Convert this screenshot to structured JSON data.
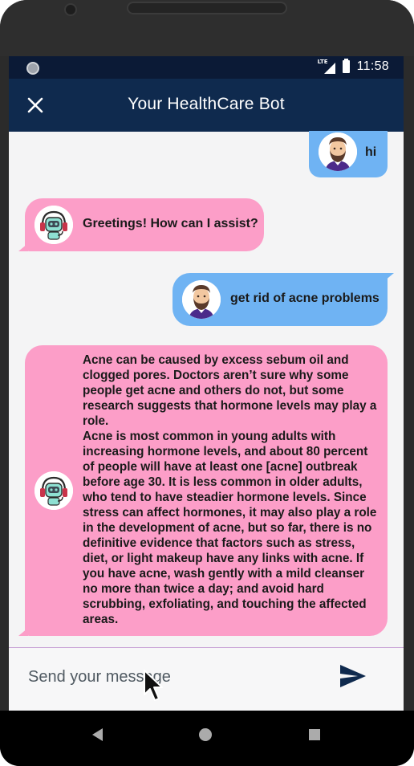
{
  "status_bar": {
    "network_label": "LTE",
    "time": "11:58",
    "icons": [
      "notification-dot-icon",
      "lte-signal-icon",
      "battery-icon"
    ]
  },
  "app_bar": {
    "title": "Your HealthCare Bot",
    "close_icon": "close-icon"
  },
  "colors": {
    "status_bar": "#0b1a36",
    "app_bar": "#0f2a4e",
    "user_bubble": "#6fb3f3",
    "bot_bubble": "#fc9ec8",
    "chat_background": "#f4f4f5",
    "send_icon": "#0f2a4e"
  },
  "messages": [
    {
      "sender": "user",
      "avatar": "bearded-man-avatar-icon",
      "text": "hi"
    },
    {
      "sender": "bot",
      "avatar": "robot-headset-avatar-icon",
      "text": "Greetings! How can I assist?"
    },
    {
      "sender": "user",
      "avatar": "bearded-man-avatar-icon",
      "text": "get rid of acne problems"
    },
    {
      "sender": "bot",
      "avatar": "robot-headset-avatar-icon",
      "text": "Acne can be caused by excess sebum oil and clogged pores. Doctors aren’t sure why some people get acne and others do not, but some research suggests that hormone levels may play a role.\nAcne is most common in young adults with increasing hormone levels, and about 80 percent of people will have at least one [acne] outbreak before age 30. It is less common in older adults, who tend to have steadier hormone levels. Since stress can affect hormones, it may also play a role in the development of acne, but so far, there is no definitive evidence that factors such as stress, diet, or light makeup have any links with acne. If you have acne, wash gently with a mild cleanser no more than twice a day; and avoid hard scrubbing, exfoliating, and touching the affected areas."
    }
  ],
  "composer": {
    "placeholder": "Send your message",
    "value": "",
    "send_icon": "send-icon"
  },
  "nav_bar": {
    "icons": [
      "back-icon",
      "home-icon",
      "recent-apps-icon"
    ]
  }
}
